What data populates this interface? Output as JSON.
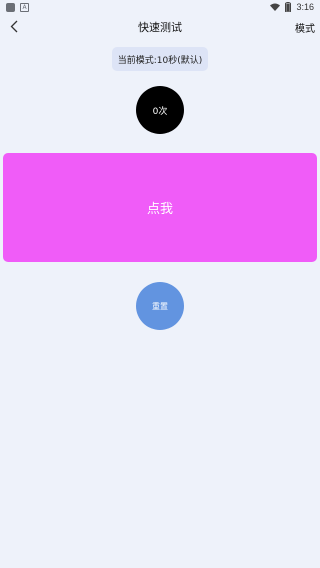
{
  "status_bar": {
    "time": "3:16",
    "icons": [
      "app-notification-icon",
      "a-notification-icon",
      "wifi-icon",
      "battery-icon"
    ]
  },
  "nav": {
    "title": "快速测试",
    "mode_label": "模式",
    "back_icon": "chevron-left-icon"
  },
  "mode_badge": {
    "text": "当前模式:10秒(默认)"
  },
  "counter": {
    "text": "0次"
  },
  "tap_area": {
    "label": "点我"
  },
  "reset": {
    "label": "重置"
  },
  "colors": {
    "background": "#eef2fa",
    "tap_area": "#f05cf8",
    "counter": "#000000",
    "reset": "#6294e0",
    "badge": "#dde4f6"
  }
}
